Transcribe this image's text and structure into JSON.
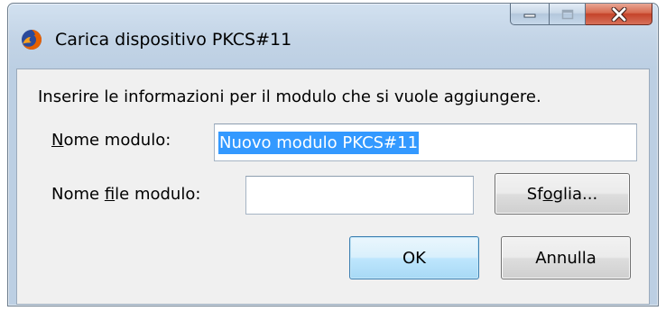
{
  "window": {
    "title": "Carica dispositivo PKCS#11",
    "icon": "firefox-icon",
    "caption_buttons": [
      "minimize-icon",
      "maximize-icon",
      "close-icon"
    ]
  },
  "dialog": {
    "intro": "Inserire le informazioni per il modulo che si vuole aggiungere.",
    "module_name": {
      "label_mnemonic": "N",
      "label_rest": "ome modulo:",
      "value": "Nuovo modulo PKCS#11",
      "selected": true
    },
    "module_file": {
      "label_before": "Nome ",
      "label_mnemonic": "f",
      "label_after": "ile modulo:",
      "value": ""
    },
    "browse_button": {
      "label_before": "Sf",
      "label_mnemonic": "o",
      "label_after": "glia..."
    },
    "ok_label": "OK",
    "cancel_label": "Annulla"
  },
  "colors": {
    "selection": "#3399ff",
    "close_button": "#c4432a",
    "frame": "#bccfe3"
  }
}
